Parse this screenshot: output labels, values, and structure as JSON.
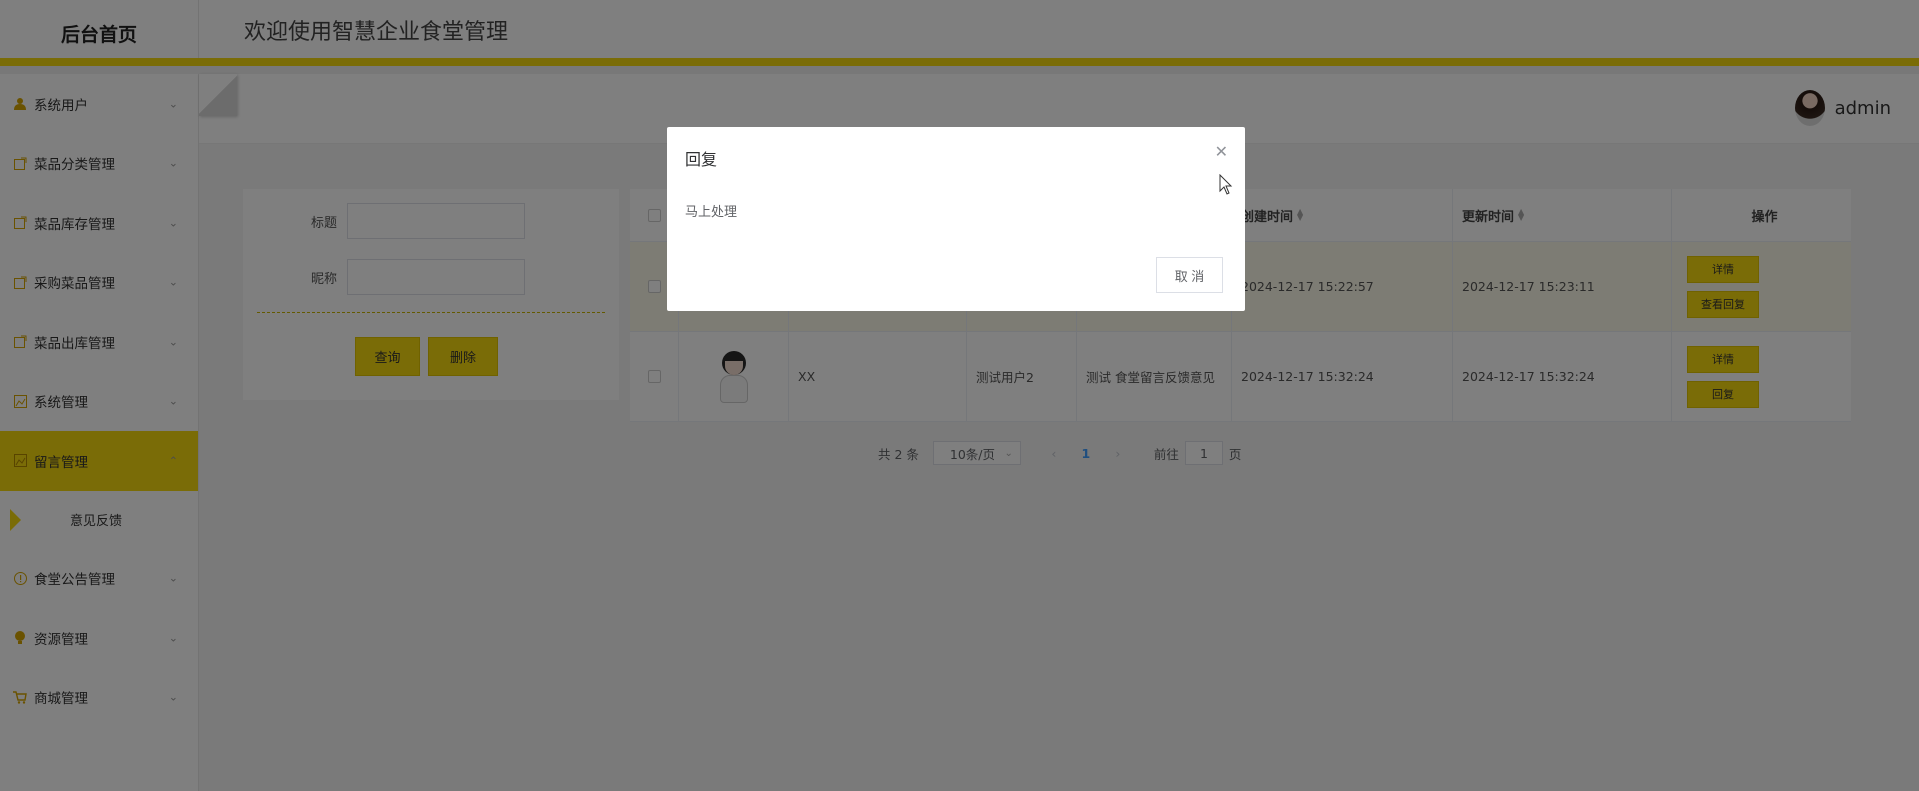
{
  "header": {
    "brand": "后台首页",
    "welcome": "欢迎使用智慧企业食堂管理"
  },
  "sidebar": {
    "items": [
      {
        "label": "系统用户",
        "icon": "user-icon"
      },
      {
        "label": "菜品分类管理",
        "icon": "edit-icon"
      },
      {
        "label": "菜品库存管理",
        "icon": "edit-icon"
      },
      {
        "label": "采购菜品管理",
        "icon": "edit-icon"
      },
      {
        "label": "菜品出库管理",
        "icon": "edit-icon"
      },
      {
        "label": "系统管理",
        "icon": "picture-icon"
      },
      {
        "label": "留言管理",
        "icon": "picture-icon",
        "expanded": true
      },
      {
        "label": "食堂公告管理",
        "icon": "info-icon"
      },
      {
        "label": "资源管理",
        "icon": "bulb-icon"
      },
      {
        "label": "商城管理",
        "icon": "cart-icon"
      }
    ],
    "sub_item": "意见反馈",
    "accent_color": "#f5d80f"
  },
  "topbar": {
    "username": "admin"
  },
  "search": {
    "title_label": "标题",
    "nickname_label": "昵称",
    "query_button": "查询",
    "delete_button": "删除"
  },
  "table": {
    "headers": {
      "create_time": "创建时间",
      "update_time": "更新时间",
      "operation": "操作"
    },
    "rows": [
      {
        "create_time": "2024-12-17 15:22:57",
        "update_time": "2024-12-17 15:23:11",
        "actions": [
          "详情",
          "查看回复"
        ]
      },
      {
        "nickname": "XX",
        "username": "测试用户2",
        "content": "测试 食堂留言反馈意见",
        "create_time": "2024-12-17 15:32:24",
        "update_time": "2024-12-17 15:32:24",
        "actions": [
          "详情",
          "回复"
        ]
      }
    ]
  },
  "pagination": {
    "total": "共 2 条",
    "page_size": "10条/页",
    "current_page": "1",
    "goto_label": "前往",
    "goto_value": "1",
    "page_suffix": "页"
  },
  "dialog": {
    "title": "回复",
    "body": "马上处理",
    "cancel": "取 消"
  }
}
